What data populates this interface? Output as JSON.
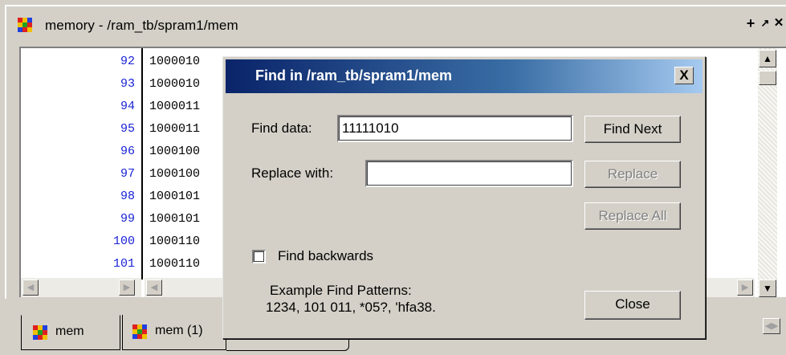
{
  "window": {
    "title": "memory - /ram_tb/spram1/mem",
    "controls": {
      "dock": "+",
      "undock": "↗",
      "close": "✕"
    }
  },
  "memory": {
    "addresses": [
      "92",
      "93",
      "94",
      "95",
      "96",
      "97",
      "98",
      "99",
      "100",
      "101"
    ],
    "values": [
      "1000010",
      "1000010",
      "1000011",
      "1000011",
      "1000100",
      "1000100",
      "1000101",
      "1000101",
      "1000110",
      "1000110"
    ],
    "address_color": "#1a22d6"
  },
  "tabs": [
    {
      "label": "mem"
    },
    {
      "label": "mem (1)"
    }
  ],
  "dialog": {
    "title": "Find in /ram_tb/spram1/mem",
    "close_glyph": "X",
    "find_label": "Find data:",
    "find_value": "11111010",
    "replace_label": "Replace with:",
    "replace_value": "",
    "buttons": {
      "find_next": "Find Next",
      "replace": "Replace",
      "replace_all": "Replace All",
      "close": "Close"
    },
    "find_backwards_label": "Find backwards",
    "find_backwards_checked": false,
    "example_heading": "Example Find Patterns:",
    "example_patterns": "1234, 101 011, *05?, 'hfa38."
  },
  "colors": {
    "title_gradient_start": "#0a246a",
    "title_gradient_end": "#a6caf0",
    "face": "#d4d0c8"
  }
}
